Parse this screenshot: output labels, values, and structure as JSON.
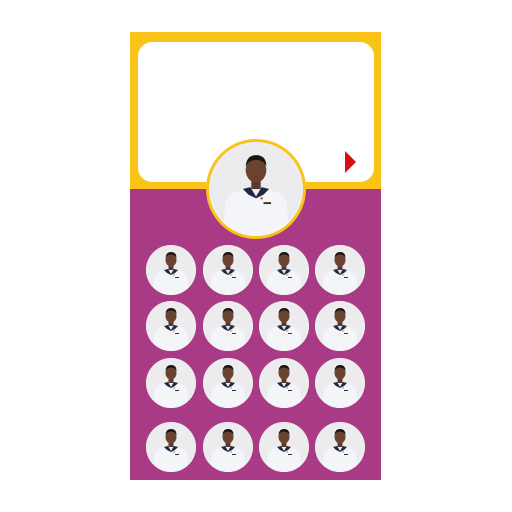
{
  "colors": {
    "header": "#f9c317",
    "background": "#a93a86",
    "card": "#ffffff",
    "arrow": "#d90d12"
  },
  "header": {
    "next_icon": "triangle-right-icon"
  },
  "profile": {
    "image": "person-photo"
  },
  "gallery": {
    "rows": 4,
    "columns": 4,
    "image": "person-photo"
  }
}
